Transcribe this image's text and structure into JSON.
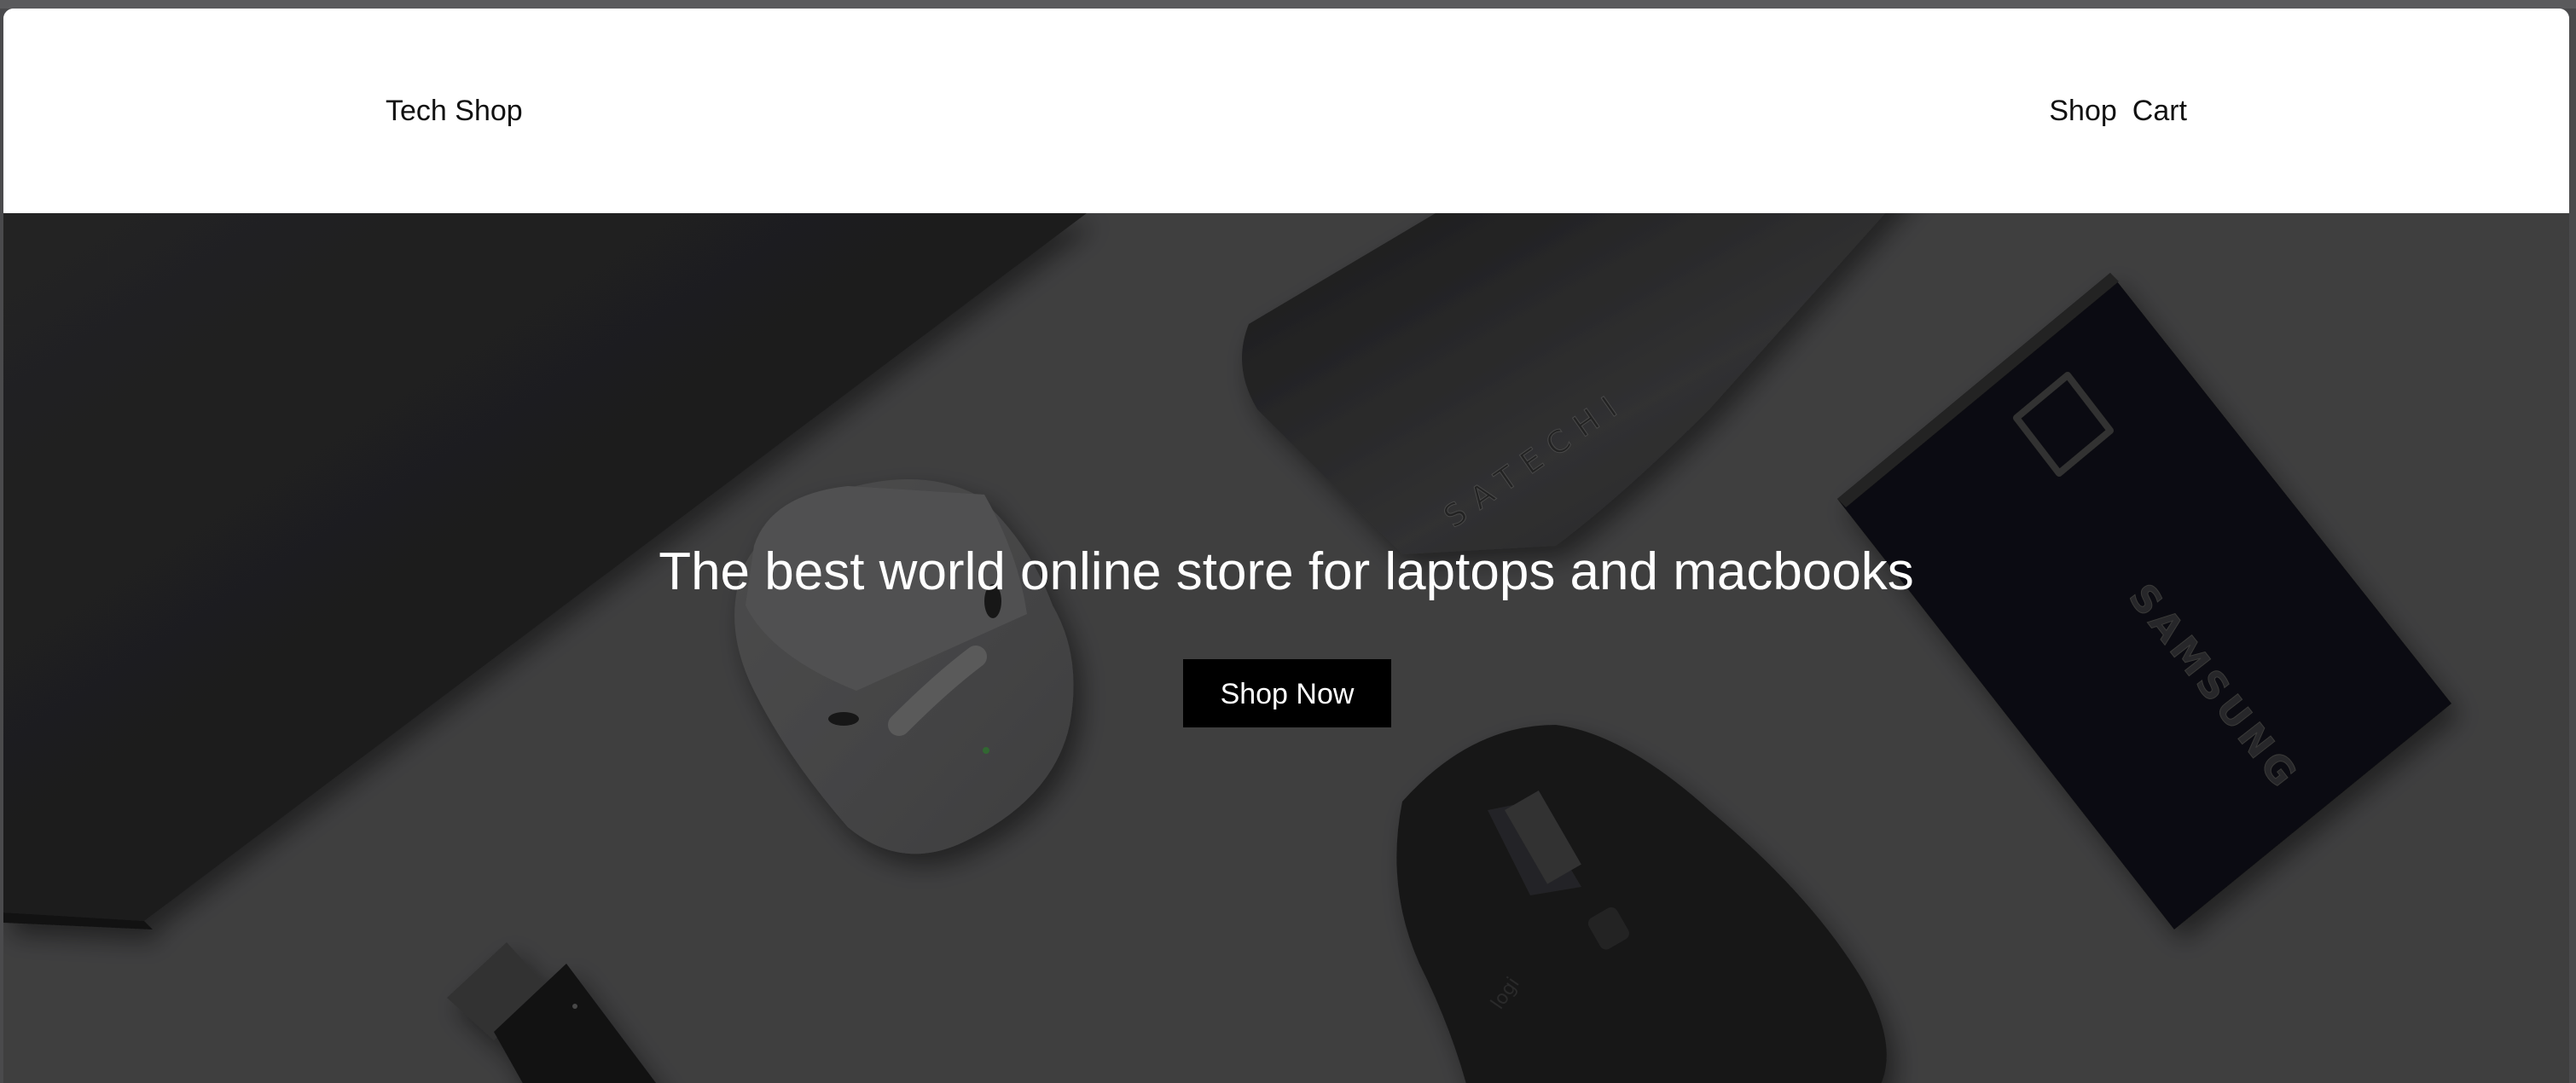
{
  "navbar": {
    "brand": "Tech Shop",
    "links": [
      "Shop",
      "Cart"
    ]
  },
  "hero": {
    "title": "The best world online store for laptops and macbooks",
    "cta_label": "Shop Now",
    "product_labels": {
      "hub": "SATECHI",
      "ssd": "SAMSUNG",
      "mouse": "logi"
    }
  },
  "colors": {
    "navbar_bg": "#ffffff",
    "hero_bg": "#3f3f40",
    "cta_bg": "#000000",
    "cta_text": "#ffffff",
    "hero_text": "#ffffff"
  }
}
